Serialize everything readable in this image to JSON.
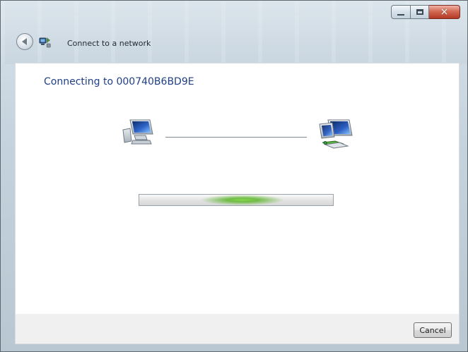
{
  "window": {
    "title": "Connect to a network",
    "caption_buttons": {
      "minimize_icon": "minimize-icon",
      "maximize_icon": "maximize-icon",
      "close_icon": "close-icon",
      "close_glyph": "×"
    }
  },
  "content": {
    "heading": "Connecting to 000740B6BD9E",
    "progress": {
      "state": "indeterminate",
      "accent": "#79c93b"
    },
    "icons": {
      "back": "back-arrow-icon",
      "nav": "network-wizard-icon",
      "left": "computer-icon",
      "right": "network-computers-icon"
    }
  },
  "footer": {
    "cancel_label": "Cancel"
  },
  "colors": {
    "heading": "#1f3f86",
    "progress_glow": "#79c93b",
    "button_bar": "#f0f0f0",
    "close_button": "#d36a54"
  }
}
